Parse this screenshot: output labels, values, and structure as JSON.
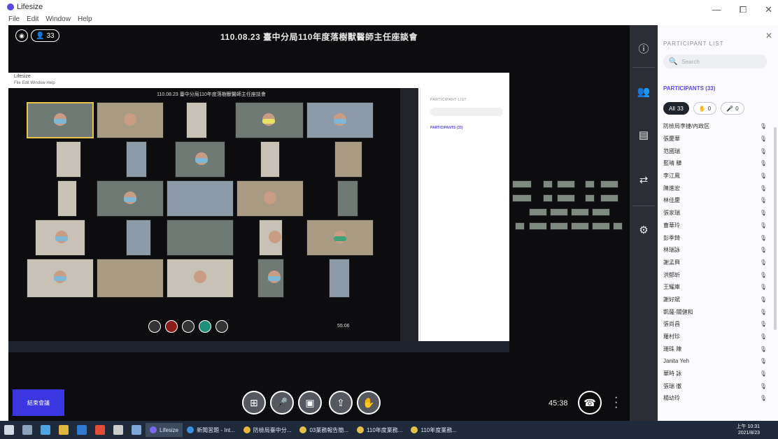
{
  "window": {
    "app_title": "Lifesize",
    "menu": [
      "File",
      "Edit",
      "Window",
      "Help"
    ],
    "controls": [
      "—",
      "⧠",
      "✕"
    ]
  },
  "call": {
    "meeting_title": "110.08.23 臺中分局110年度落樹獸醫師主任座談會",
    "participant_count_pill": "33",
    "timer": "45:38",
    "end_note_label": "結束會議"
  },
  "shared_screen": {
    "app_title": "Lifesize",
    "menu": "File  Edit  Window  Help",
    "meeting_title": "110.08.23 臺中分局110年度落樹獸醫師主任座談會",
    "list_header": "PARTICIPANT LIST",
    "participants_label": "PARTICIPANTS (33)",
    "timer": "55:06"
  },
  "participant_list": {
    "header": "PARTICIPANT LIST",
    "search_placeholder": "Search",
    "participants_label": "PARTICIPANTS (33)",
    "filters": [
      {
        "label": "All",
        "count": "33"
      },
      {
        "label": "",
        "count": "0"
      },
      {
        "label": "",
        "count": "0"
      }
    ],
    "names": [
      "防檢局李捷/內政区",
      "張慶華",
      "范國瑞",
      "藍晴 驊",
      "李江鳳",
      "陳進宏",
      "林佳慶",
      "張家瑞",
      "曹華玲",
      "彭季錡",
      "林瑞詠",
      "謝孟興",
      "洪郁昕",
      "王耀庫",
      "謝好斌",
      "凱薩-關健和",
      "張尚昌",
      "羅村珍",
      "珊珠 陳",
      "Janita Yeh",
      "華時 詠",
      "張瑞 徹",
      "楊幼玲"
    ]
  },
  "taskbar": {
    "apps": [
      "Lifesize",
      "新聞習題 - Int...",
      "防檢局臺中分...",
      "03業務報告簡...",
      "110年度業務...",
      "110年度業務..."
    ],
    "time": "上午 10:31",
    "date": "2021/8/23"
  }
}
